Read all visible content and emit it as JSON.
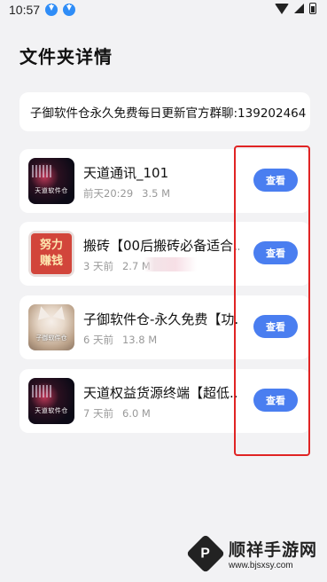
{
  "status_bar": {
    "time": "10:57"
  },
  "page": {
    "title": "文件夹详情"
  },
  "notice": {
    "text": "子御软件仓永久免费每日更新官方群聊:139202464"
  },
  "files": [
    {
      "name": "天道通讯_101",
      "time": "前天20:29",
      "size": "3.5 M",
      "thumb_caption": "天道软件仓",
      "button_label": "查看"
    },
    {
      "name": "搬砖【00后搬砖必备适合...",
      "time": "3 天前",
      "size": "2.7 M",
      "thumb_line1": "努力",
      "thumb_line2": "赚钱",
      "button_label": "查看"
    },
    {
      "name": "子御软件仓-永久免费【功...",
      "time": "6 天前",
      "size": "13.8 M",
      "thumb_caption": "子御软件仓",
      "button_label": "查看"
    },
    {
      "name": "天道权益货源终端【超低...",
      "time": "7 天前",
      "size": "6.0 M",
      "thumb_caption": "天道软件仓",
      "button_label": "查看"
    }
  ],
  "watermark": {
    "logo_letter": "P",
    "name": "顺祥手游网",
    "url": "www.bjsxsy.com"
  },
  "colors": {
    "accent": "#4a7ef0",
    "highlight": "#e02424",
    "background": "#f2f2f4"
  }
}
